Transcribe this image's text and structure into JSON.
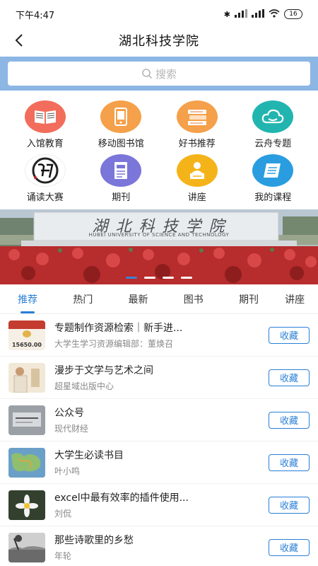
{
  "status_bar": {
    "time": "下午4:47",
    "battery": "16"
  },
  "header": {
    "title": "湖北科技学院"
  },
  "search": {
    "placeholder": "搜索"
  },
  "grid": [
    {
      "label": "入馆教育",
      "icon": "open-book-icon",
      "color": "#f26d5b"
    },
    {
      "label": "移动图书馆",
      "icon": "mobile-library-icon",
      "color": "#f5a04a"
    },
    {
      "label": "好书推荐",
      "icon": "book-stack-icon",
      "color": "#f5a04a"
    },
    {
      "label": "云舟专题",
      "icon": "cloud-icon",
      "color": "#22b5b0"
    },
    {
      "label": "诵读大赛",
      "icon": "fu-calligraphy-icon",
      "color": "#ffffff"
    },
    {
      "label": "期刊",
      "icon": "journal-icon",
      "color": "#7b76d9"
    },
    {
      "label": "讲座",
      "icon": "lecture-icon",
      "color": "#f5b31a"
    },
    {
      "label": "我的课程",
      "icon": "course-icon",
      "color": "#2a9de0"
    }
  ],
  "banner": {
    "sign_text": "湖 北 科 技 学 院",
    "sign_sub": "HUBEI UNIVERSITY OF SCIENCE AND TECHNOLOGY",
    "active_index": 0,
    "count": 4
  },
  "tabs": [
    "推荐",
    "热门",
    "最新",
    "图书",
    "期刊",
    "讲座"
  ],
  "list": [
    {
      "title": "专题制作资源检索｜新手进...",
      "subtitle": "大学生学习资源编辑部：董焕召",
      "thumb_text": "15650.00",
      "button": "收藏"
    },
    {
      "title": "漫步于文学与艺术之间",
      "subtitle": "超星域出版中心",
      "thumb_text": "",
      "button": "收藏"
    },
    {
      "title": "公众号",
      "subtitle": "现代财经",
      "thumb_text": "",
      "button": "收藏"
    },
    {
      "title": "大学生必读书目",
      "subtitle": "叶小鸣",
      "thumb_text": "",
      "button": "收藏"
    },
    {
      "title": "excel中最有效率的插件使用...",
      "subtitle": "刘侃",
      "thumb_text": "",
      "button": "收藏"
    },
    {
      "title": "那些诗歌里的乡愁",
      "subtitle": "年轮",
      "thumb_text": "",
      "button": "收藏"
    }
  ]
}
